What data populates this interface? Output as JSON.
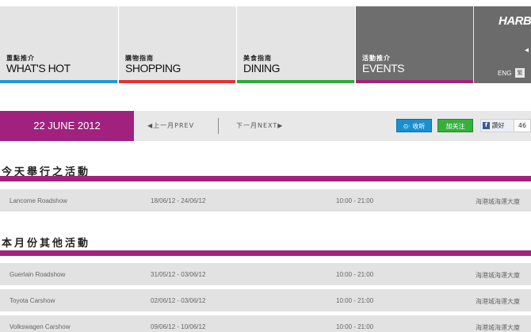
{
  "nav": [
    {
      "zh": "重點推介",
      "en": "WHAT'S HOT",
      "color": "#1e9ad6"
    },
    {
      "zh": "購物指南",
      "en": "SHOPPING",
      "color": "#e8312f"
    },
    {
      "zh": "美食指南",
      "en": "DINING",
      "color": "#2fa83a"
    },
    {
      "zh": "活動推介",
      "en": "EVENTS",
      "color": "#a1227e"
    }
  ],
  "brand": {
    "logo": "HARB",
    "lang_en": "ENG",
    "lang_zh": "繁"
  },
  "datebar": {
    "date": "22 JUNE 2012",
    "prev": "◀上一月PREV",
    "next": "下一月NEXT▶",
    "weibo": "收听",
    "follow": "加关注",
    "fb_like": "讚好",
    "fb_count": "46"
  },
  "sections": [
    {
      "title": "今天舉行之活動",
      "rows": [
        {
          "name": "Lancome Roadshow",
          "date": "18/06/12 - 24/06/12",
          "time": "10:00 - 21:00",
          "venue": "海港城海運大廈"
        }
      ]
    },
    {
      "title": "本月份其他活動",
      "rows": [
        {
          "name": "Guerlain Roadshow",
          "date": "31/05/12 - 03/06/12",
          "time": "10:00 - 21:00",
          "venue": "海港城海運大廈"
        },
        {
          "name": "Toyota Carshow",
          "date": "02/06/12 - 03/06/12",
          "time": "10:00 - 21:00",
          "venue": "海港城海運大廈"
        },
        {
          "name": "Volkswagen Carshow",
          "date": "09/06/12 - 10/06/12",
          "time": "10:00 - 21:00",
          "venue": "海港城海運大廈"
        }
      ]
    }
  ]
}
